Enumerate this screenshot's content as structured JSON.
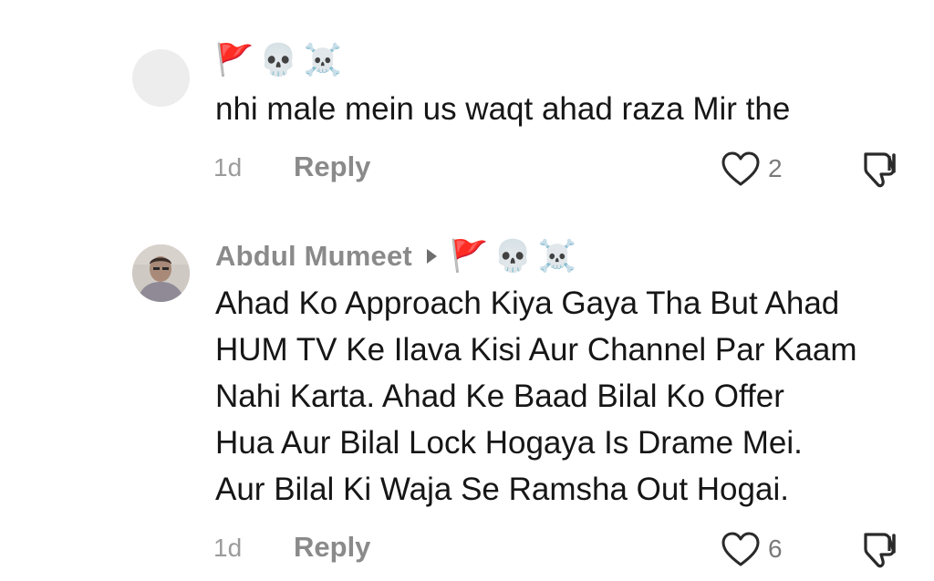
{
  "comments": [
    {
      "username": "",
      "emojis": [
        "🚩",
        "💀",
        "☠️"
      ],
      "text": "nhi male mein us waqt ahad raza Mir the",
      "time": "1d",
      "reply_label": "Reply",
      "likes": "2"
    },
    {
      "username": "Abdul Mumeet",
      "emojis": [
        "🚩",
        "💀",
        "☠️"
      ],
      "text": "Ahad Ko Approach Kiya Gaya Tha But Ahad\nHUM TV Ke Ilava Kisi Aur Channel Par Kaam\nNahi Karta. Ahad Ke Baad Bilal Ko Offer\nHua Aur Bilal Lock Hogaya Is Drame Mei.\nAur Bilal Ki Waja Se Ramsha Out Hogai.",
      "time": "1d",
      "reply_label": "Reply",
      "likes": "6"
    }
  ],
  "icons": {
    "like": "heart-outline-icon",
    "dislike": "thumbs-down-icon",
    "reply_caret": "caret-right-icon"
  },
  "colors": {
    "username": "#8a8a8a",
    "text": "#161616",
    "meta": "#9b9b9b"
  }
}
